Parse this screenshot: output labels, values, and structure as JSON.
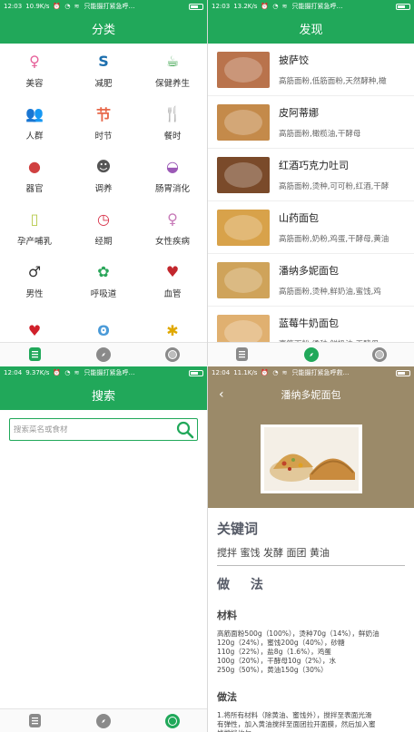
{
  "colors": {
    "green": "#21a85a",
    "tan": "#9b8a69"
  },
  "screens": {
    "categories": {
      "status": {
        "time": "12:03",
        "speed": "10.9K/s",
        "signal": "移·",
        "notice": "只能摄打紧急呼…"
      },
      "title": "分类",
      "items": [
        {
          "label": "美容",
          "icon": "woman-face-icon",
          "glyph": "♀",
          "color": "#e6619a"
        },
        {
          "label": "减肥",
          "icon": "body-slim-icon",
          "glyph": "S",
          "color": "#1d6fae"
        },
        {
          "label": "保健养生",
          "icon": "tea-cup-icon",
          "glyph": "☕",
          "color": "#2a9a3c"
        },
        {
          "label": "人群",
          "icon": "people-icon",
          "glyph": "👥",
          "color": "#1fa79b"
        },
        {
          "label": "时节",
          "icon": "festival-icon",
          "glyph": "节",
          "color": "#e8684a"
        },
        {
          "label": "餐时",
          "icon": "fork-spoon-icon",
          "glyph": "🍴",
          "color": "#f0a020"
        },
        {
          "label": "器官",
          "icon": "liver-icon",
          "glyph": "●",
          "color": "#d04040"
        },
        {
          "label": "调养",
          "icon": "head-icon",
          "glyph": "☻",
          "color": "#555555"
        },
        {
          "label": "肠胃消化",
          "icon": "stomach-icon",
          "glyph": "◒",
          "color": "#9b59b6"
        },
        {
          "label": "孕产哺乳",
          "icon": "baby-bottle-icon",
          "glyph": "▯",
          "color": "#b7c94a"
        },
        {
          "label": "经期",
          "icon": "clock-icon",
          "glyph": "◷",
          "color": "#d8324a"
        },
        {
          "label": "女性疾病",
          "icon": "female-icon",
          "glyph": "♀",
          "color": "#c77ab8"
        },
        {
          "label": "男性",
          "icon": "male-icon",
          "glyph": "♂",
          "color": "#333333"
        },
        {
          "label": "呼吸道",
          "icon": "lungs-icon",
          "glyph": "✿",
          "color": "#2aa65a"
        },
        {
          "label": "血管",
          "icon": "vessel-heart-icon",
          "glyph": "♥",
          "color": "#c2272d"
        },
        {
          "label": "",
          "icon": "heart-icon",
          "glyph": "♥",
          "color": "#d0202a"
        },
        {
          "label": "",
          "icon": "kidney-icon",
          "glyph": "ʘ",
          "color": "#4a9ad8"
        },
        {
          "label": "",
          "icon": "molecule-icon",
          "glyph": "✱",
          "color": "#e0a800"
        }
      ]
    },
    "discover": {
      "status": {
        "time": "12:03",
        "speed": "13.2K/s",
        "signal": "移·",
        "notice": "只能摄打紧急呼…"
      },
      "title": "发现",
      "items": [
        {
          "name": "披萨饺",
          "desc": "高筋面粉,低筋面粉,天然酵种,橄",
          "color": "#b9734c"
        },
        {
          "name": "皮阿蒂娜",
          "desc": "高筋面粉,橄榄油,干酵母",
          "color": "#c48a4a"
        },
        {
          "name": "红酒巧克力吐司",
          "desc": "高筋面粉,烫种,可可粉,红酒,干酵",
          "color": "#7a4a2a"
        },
        {
          "name": "山药面包",
          "desc": "高筋面粉,奶粉,鸡蛋,干酵母,黄油",
          "color": "#d8a24a"
        },
        {
          "name": "潘纳多妮面包",
          "desc": "高筋面粉,烫种,鲜奶油,蜜饯,鸡",
          "color": "#cfa35a"
        },
        {
          "name": "蓝莓牛奶面包",
          "desc": "高筋面粉,烫种,鲜奶油,干酵母",
          "color": "#e0b070"
        }
      ]
    },
    "search": {
      "status": {
        "time": "12:04",
        "speed": "9.37K/s",
        "signal": "移·",
        "notice": "只能摄打紧急呼…"
      },
      "title": "搜索",
      "placeholder": "搜索菜名或食材"
    },
    "detail": {
      "status": {
        "time": "12:04",
        "speed": "11.1K/s",
        "signal": "移动·",
        "notice": "只能摄打紧急呼救…"
      },
      "title": "潘纳多妮面包",
      "back": "‹",
      "keywords_title": "关键词",
      "keywords": "搅拌 蜜饯 发酵 面团 黄油",
      "method_title": "做 法",
      "ingredients_title": "材料",
      "ingredients": [
        "高筋面粉500g（100%），烫种70g（14%），鲜奶油",
        "120g（24%），蜜饯200g（40%），砂糖",
        "110g（22%），盐8g（1.6%），鸡蛋",
        "100g（20%），干酵母10g（2%），水",
        "250g（50%），黄油150g（30%）"
      ],
      "steps_title": "做法",
      "steps": [
        "1.将所有材料（除黄油、蜜饯外），搅拌至表面光滑",
        "有弹性，加入黄油搅拌至面团拉开面膜，然后加入蜜",
        "饯搅拌均匀"
      ]
    }
  }
}
